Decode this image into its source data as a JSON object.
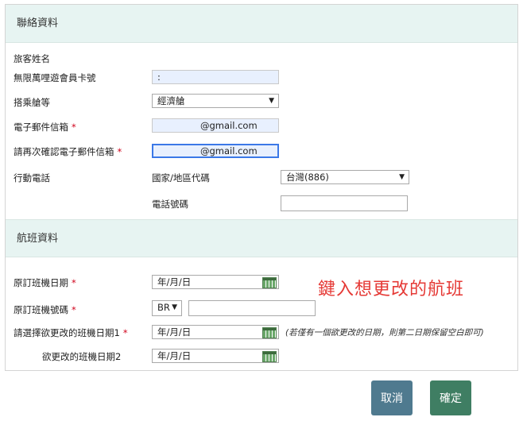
{
  "contact": {
    "title": "聯絡資料",
    "passenger_name_label": "旅客姓名",
    "member_card_label": "無限萬哩遊會員卡號",
    "member_card_value": ":",
    "cabin_label": "搭乘艙等",
    "cabin_value": "經濟艙",
    "email_label": "電子郵件信箱",
    "email_value": "@gmail.com",
    "email_confirm_label": "請再次確認電子郵件信箱",
    "email_confirm_value": "@gmail.com",
    "mobile_label": "行動電話",
    "country_code_label": "國家/地區代碼",
    "country_code_value": "台灣(886)",
    "phone_label": "電話號碼",
    "phone_value": ""
  },
  "flight": {
    "title": "航班資料",
    "orig_date_label": "原訂班機日期",
    "orig_date_placeholder": "年/月/日",
    "orig_flight_label": "原訂班機號碼",
    "airline_code": "BR",
    "flight_number_value": "",
    "new_date1_label": "請選擇欲更改的班機日期1",
    "new_date1_placeholder": "年/月/日",
    "new_date1_note": "(若僅有一個欲更改的日期，則第二日期保留空白即可)",
    "new_date2_label": "欲更改的班機日期2",
    "new_date2_placeholder": "年/月/日"
  },
  "annotation": "鍵入想更改的航班",
  "buttons": {
    "cancel": "取消",
    "confirm": "確定"
  },
  "colors": {
    "section_bg": "#e7f4f2",
    "required": "#d0021b",
    "annotation": "#e53935",
    "cancel_bg": "#4f7a8f",
    "confirm_bg": "#3f7e63"
  }
}
